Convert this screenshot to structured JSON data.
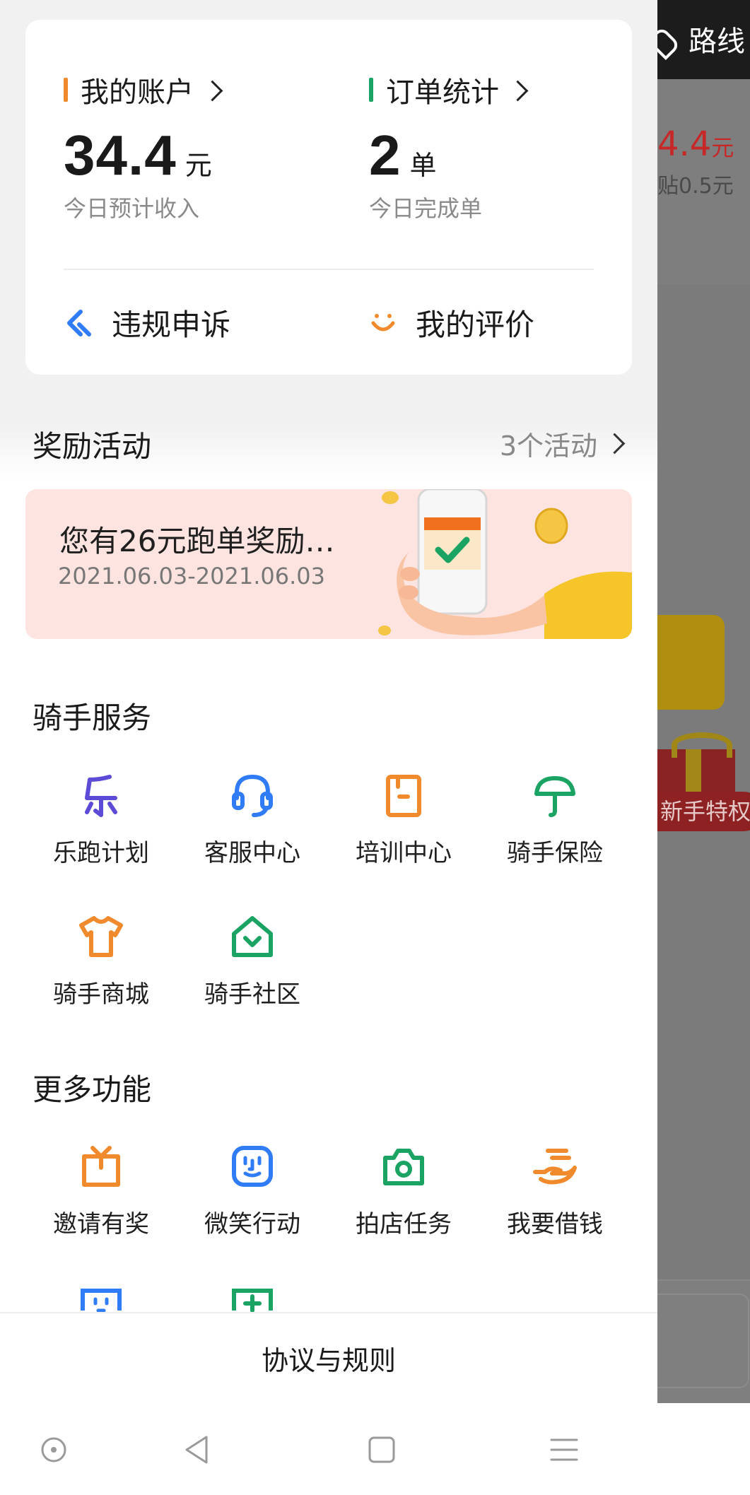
{
  "background_app": {
    "route_label": "路线",
    "price_value": "4.4",
    "price_unit": "元",
    "subsidy_text": "贴0.5元",
    "newbie_badge": "新手特权"
  },
  "account_card": {
    "account": {
      "title": "我的账户",
      "value": "34.4",
      "unit": "元",
      "caption": "今日预计收入"
    },
    "orders": {
      "title": "订单统计",
      "value": "2",
      "unit": "单",
      "caption": "今日完成单"
    },
    "appeal_label": "违规申诉",
    "rating_label": "我的评价"
  },
  "rewards": {
    "title": "奖励活动",
    "count_label": "3个活动",
    "banner_text": "您有26元跑单奖励…",
    "banner_date": "2021.06.03-2021.06.03"
  },
  "rider_services": {
    "title": "骑手服务",
    "items": [
      "乐跑计划",
      "客服中心",
      "培训中心",
      "骑手保险",
      "骑手商城",
      "骑手社区"
    ]
  },
  "more_functions": {
    "title": "更多功能",
    "items": [
      "邀请有奖",
      "微笑行动",
      "拍店任务",
      "我要借钱"
    ]
  },
  "footer": {
    "link": "协议与规则"
  },
  "colors": {
    "orange": "#f08a2c",
    "green": "#1aa363",
    "blue": "#2f7cf6",
    "purple": "#5b4bd6",
    "teal": "#1aa363",
    "red_price": "#c62828"
  },
  "icons": {
    "appeal": "appeal-icon",
    "rating": "smile-icon",
    "rider_services": [
      "le-icon",
      "headset-icon",
      "book-icon",
      "umbrella-icon",
      "tshirt-icon",
      "house-icon"
    ],
    "more_functions": [
      "gift-box-icon",
      "smile-face-icon",
      "camera-icon",
      "hand-coin-icon"
    ]
  }
}
